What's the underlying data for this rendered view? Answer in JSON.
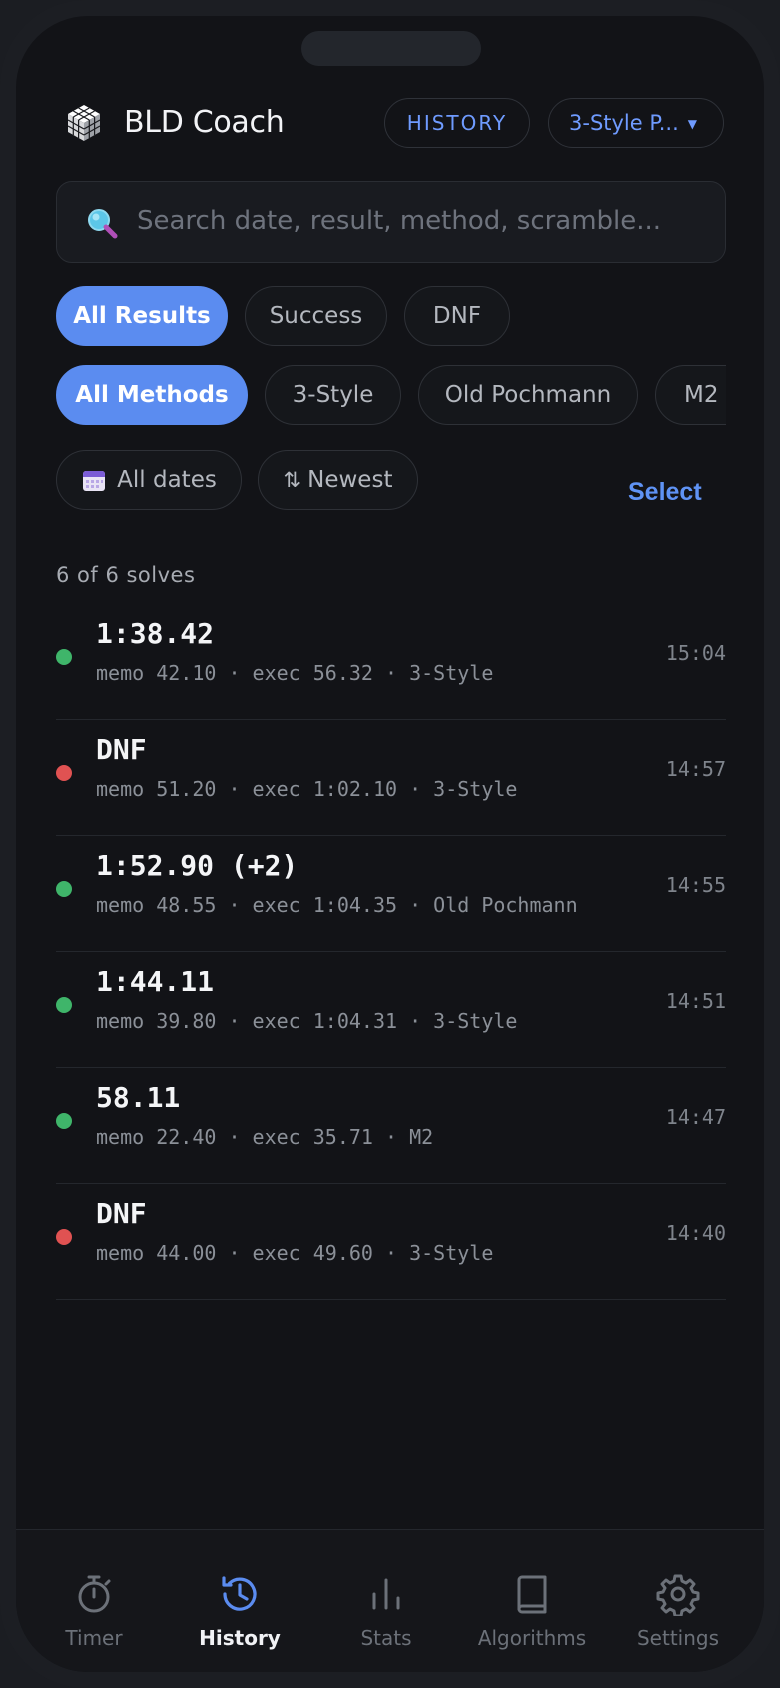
{
  "app": {
    "title": "BLD Coach",
    "logo_icon": "cube-logo-icon"
  },
  "header": {
    "history_label": "HISTORY",
    "method_selector_label": "3-Style P...",
    "accent_color": "#6f9bff"
  },
  "search": {
    "placeholder": "Search date, result, method, scramble...",
    "icon": "search-icon"
  },
  "filters": {
    "results": [
      {
        "label": "All Results",
        "active": true
      },
      {
        "label": "Success",
        "active": false
      },
      {
        "label": "DNF",
        "active": false
      }
    ],
    "methods": [
      {
        "label": "All Methods",
        "active": true
      },
      {
        "label": "3-Style",
        "active": false
      },
      {
        "label": "Old Pochmann",
        "active": false
      },
      {
        "label": "M2",
        "active": false
      }
    ],
    "date_label": "All dates",
    "sort_label": "Newest",
    "select_label": "Select"
  },
  "summary": {
    "count_text": "6 of 6 solves"
  },
  "solves": [
    {
      "time": "1:38.42",
      "detail": "memo 42.10 · exec 56.32 · 3-Style",
      "clock": "15:04",
      "status": "success"
    },
    {
      "time": "DNF",
      "detail": "memo 51.20 · exec 1:02.10 · 3-Style",
      "clock": "14:57",
      "status": "dnf"
    },
    {
      "time": "1:52.90 (+2)",
      "detail": "memo 48.55 · exec 1:04.35 · Old Pochmann",
      "clock": "14:55",
      "status": "success"
    },
    {
      "time": "1:44.11",
      "detail": "memo 39.80 · exec 1:04.31 · 3-Style",
      "clock": "14:51",
      "status": "success"
    },
    {
      "time": "58.11",
      "detail": "memo 22.40 · exec 35.71 · M2",
      "clock": "14:47",
      "status": "success"
    },
    {
      "time": "DNF",
      "detail": "memo 44.00 · exec 49.60 · 3-Style",
      "clock": "14:40",
      "status": "dnf"
    }
  ],
  "status_colors": {
    "success": "#3fb56a",
    "dnf": "#e05252"
  },
  "tabs": [
    {
      "label": "Timer",
      "icon": "stopwatch-icon",
      "active": false
    },
    {
      "label": "History",
      "icon": "history-icon",
      "active": true
    },
    {
      "label": "Stats",
      "icon": "bar-chart-icon",
      "active": false
    },
    {
      "label": "Algorithms",
      "icon": "book-icon",
      "active": false
    },
    {
      "label": "Settings",
      "icon": "gear-icon",
      "active": false
    }
  ]
}
